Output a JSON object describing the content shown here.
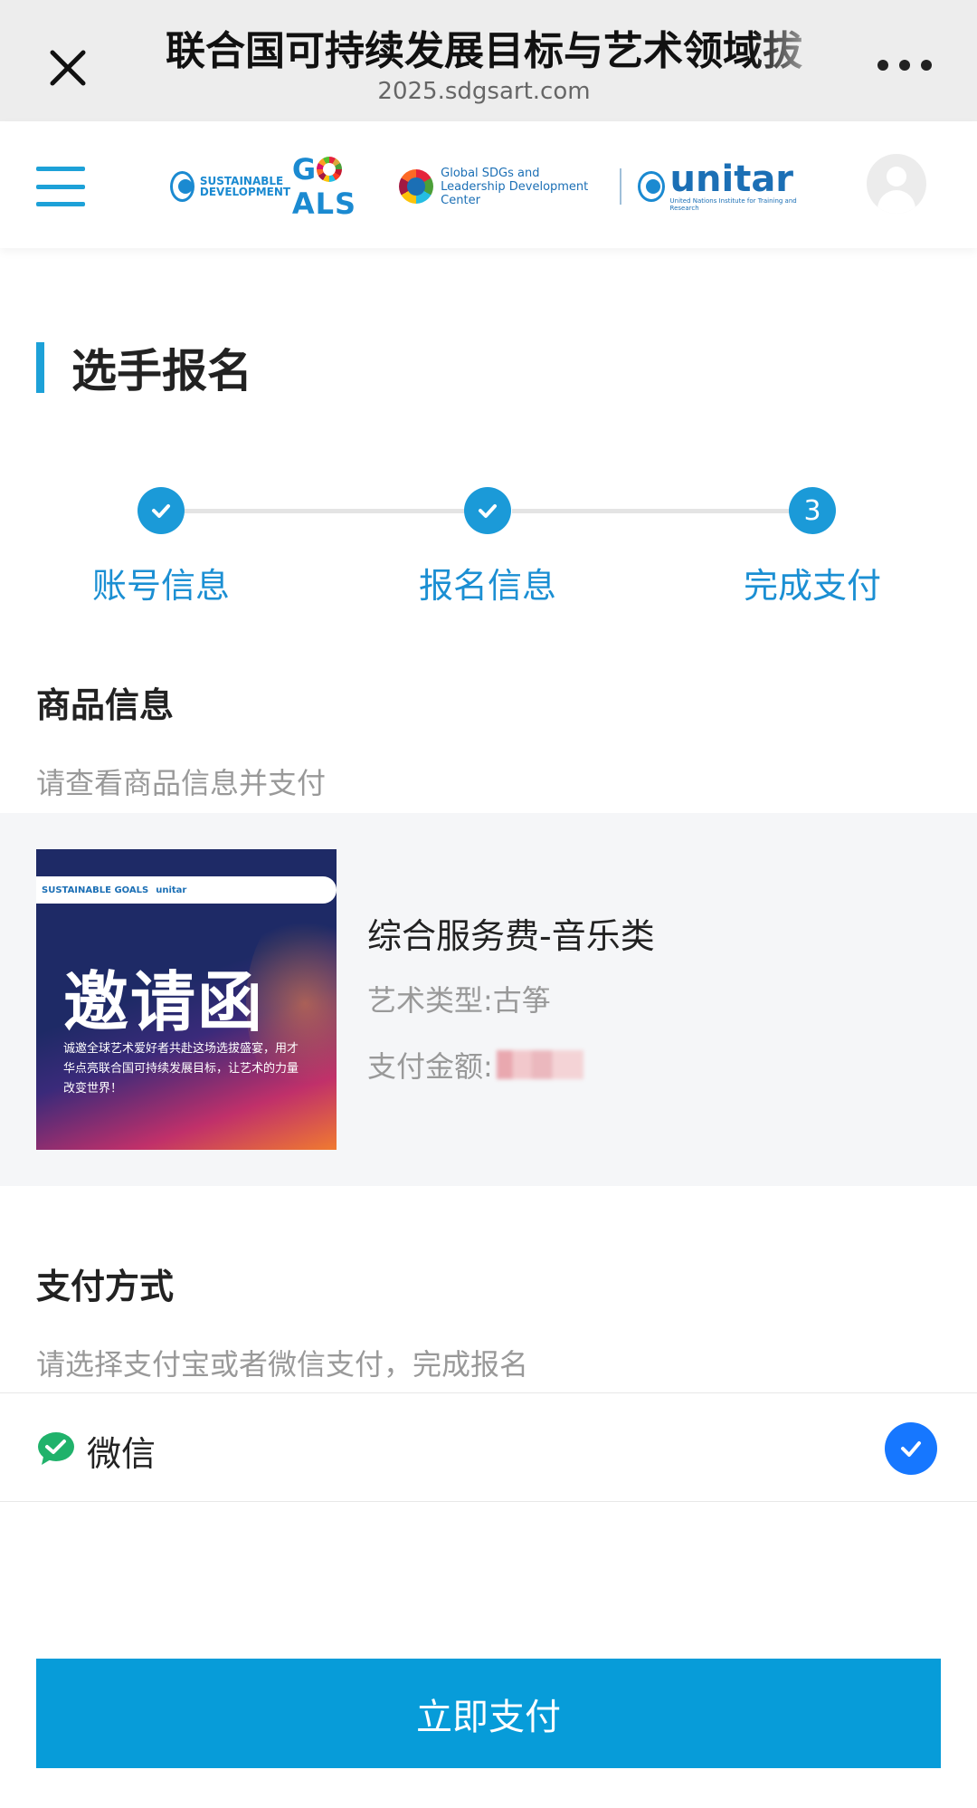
{
  "browser": {
    "title": "联合国可持续发展目标与艺术领域拔",
    "url": "2025.sdgsart.com"
  },
  "header": {
    "logo_sdg_small": "SUSTAINABLE DEVELOPMENT",
    "logo_goals_g": "G",
    "logo_goals_rest": "ALS",
    "logo_center_text": "Global SDGs and Leadership Development Center",
    "logo_unitar": "unitar",
    "logo_unitar_sub": "United Nations Institute for Training and Research"
  },
  "page": {
    "section_title": "选手报名"
  },
  "stepper": {
    "steps": [
      {
        "label": "账号信息",
        "status": "done"
      },
      {
        "label": "报名信息",
        "status": "done"
      },
      {
        "label": "完成支付",
        "status": "current",
        "number": "3"
      }
    ],
    "accent": "#1b9ad8"
  },
  "product": {
    "title": "商品信息",
    "subtitle": "请查看商品信息并支付",
    "poster_headline": "邀请函",
    "poster_body": "诚邀全球艺术爱好者共赴这场选拔盛宴，用才华点亮联合国可持续发展目标，让艺术的力量改变世界！",
    "name": "综合服务费-音乐类",
    "art_type": "艺术类型:古筝",
    "amount_label": "支付金额:"
  },
  "payment": {
    "title": "支付方式",
    "subtitle": "请选择支付宝或者微信支付，完成报名",
    "method_label": "微信",
    "selected": true,
    "pay_button": "立即支付",
    "accent": "#079cd9"
  }
}
